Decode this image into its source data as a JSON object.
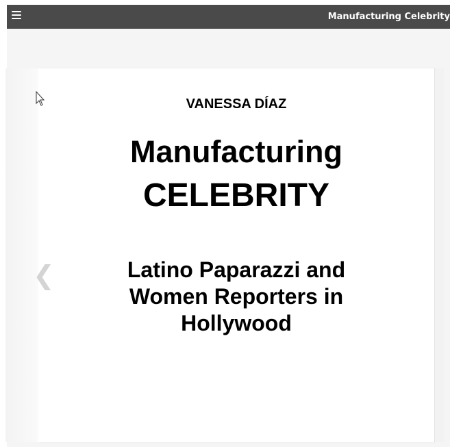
{
  "reader": {
    "title": "Manufacturing Celebrity"
  },
  "cover": {
    "author": "VANESSA DÍAZ",
    "title_line1": "Manufacturing",
    "title_line2": "CELEBRITY",
    "subtitle_lines": [
      "Latino Paparazzi and",
      "Women Reporters in",
      "Hollywood"
    ]
  },
  "navigation": {
    "prev_glyph": "❮"
  },
  "icons": [
    "menu-icon",
    "chevron-left-icon",
    "cursor-icon"
  ],
  "colors": {
    "toolbar": "#4a4a4a",
    "toolbar_text": "#ffffff",
    "page_background": "#ffffff",
    "arrow": "#d4d4d4"
  }
}
